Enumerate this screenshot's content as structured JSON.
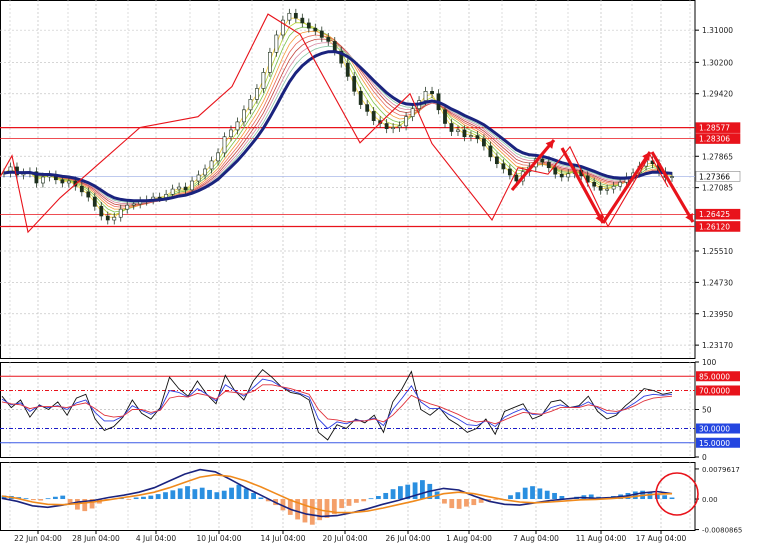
{
  "colors": {
    "background": "#ffffff",
    "grid": "#c8c8c8",
    "red_line": "#e8131b",
    "blue_line": "#1a237e",
    "current_line": "#aab8e8",
    "macd_pos": "#2a8fe0",
    "macd_neg": "#f4a06b",
    "macd_line": "#1a237e",
    "signal_line": "#f08a1c"
  },
  "chart_data": [
    {
      "type": "candlestick",
      "panel": "price",
      "y_ticks": [
        "1.31000",
        "1.30200",
        "1.29420",
        "1.27865",
        "1.27085",
        "1.25510",
        "1.24730",
        "1.23950",
        "1.23170"
      ],
      "ylim": [
        1.2285,
        1.3175
      ],
      "current_price": 1.27366,
      "price_labels": [
        {
          "label": "1.28577",
          "value": 1.28577
        },
        {
          "label": "1.28306",
          "value": 1.28306
        },
        {
          "label": "1.27366",
          "value": 1.27366
        },
        {
          "label": "1.26425",
          "value": 1.26425
        },
        {
          "label": "1.26120",
          "value": 1.2612
        }
      ],
      "support_resistance": [
        1.28577,
        1.28306,
        1.2642,
        1.2612
      ],
      "close_series": [
        1.2745,
        1.276,
        1.274,
        1.2745,
        1.2748,
        1.272,
        1.2735,
        1.274,
        1.2728,
        1.272,
        1.2725,
        1.2712,
        1.2698,
        1.2685,
        1.2662,
        1.2638,
        1.2628,
        1.2635,
        1.2655,
        1.2665,
        1.2668,
        1.2675,
        1.2678,
        1.2685,
        1.2684,
        1.2692,
        1.2705,
        1.271,
        1.2703,
        1.2725,
        1.274,
        1.2755,
        1.2775,
        1.2795,
        1.2835,
        1.2852,
        1.2872,
        1.2902,
        1.2928,
        1.2955,
        1.2995,
        1.3045,
        1.3088,
        1.3125,
        1.3142,
        1.313,
        1.3118,
        1.3105,
        1.3098,
        1.3082,
        1.3072,
        1.3048,
        1.3018,
        1.2985,
        1.2948,
        1.2915,
        1.2898,
        1.2875,
        1.2868,
        1.2855,
        1.2858,
        1.2862,
        1.2885,
        1.2905,
        1.2925,
        1.2948,
        1.2942,
        1.2902,
        1.2868,
        1.2848,
        1.2852,
        1.2835,
        1.2838,
        1.283,
        1.2812,
        1.2785,
        1.2768,
        1.2755,
        1.274,
        1.2725,
        1.2748,
        1.276,
        1.278,
        1.2772,
        1.2758,
        1.2742,
        1.2735,
        1.2743,
        1.2752,
        1.2738,
        1.2722,
        1.2712,
        1.2702,
        1.2705,
        1.2712,
        1.2722,
        1.2735,
        1.2745,
        1.2762,
        1.2775,
        1.2768,
        1.2748,
        1.2734,
        1.2736
      ]
    },
    {
      "type": "line",
      "panel": "oscillator",
      "y_ticks": [
        "100",
        "50",
        "0"
      ],
      "ylim": [
        0,
        100
      ],
      "levels": [
        {
          "label": "85.0000",
          "value": 85
        },
        {
          "label": "70.0000",
          "value": 70
        },
        {
          "label": "30.0000",
          "value": 30
        },
        {
          "label": "15.0000",
          "value": 15
        }
      ],
      "series": [
        {
          "values": [
            64,
            52,
            60,
            42,
            55,
            50,
            58,
            44,
            62,
            66,
            40,
            28,
            32,
            42,
            60,
            46,
            40,
            52,
            84,
            72,
            64,
            80,
            66,
            56,
            86,
            70,
            60,
            80,
            92,
            84,
            74,
            68,
            66,
            60,
            26,
            18,
            34,
            30,
            40,
            36,
            44,
            26,
            58,
            72,
            90,
            50,
            44,
            52,
            40,
            34,
            26,
            30,
            40,
            24,
            48,
            52,
            56,
            40,
            44,
            58,
            60,
            52,
            54,
            64,
            48,
            40,
            44,
            54,
            62,
            72,
            70,
            66,
            68
          ]
        },
        {
          "values": [
            61,
            55,
            57,
            48,
            54,
            52,
            54,
            50,
            57,
            60,
            47,
            38,
            38,
            43,
            54,
            49,
            45,
            50,
            70,
            68,
            63,
            72,
            66,
            59,
            76,
            70,
            64,
            73,
            82,
            80,
            74,
            70,
            67,
            63,
            40,
            30,
            37,
            35,
            39,
            38,
            41,
            33,
            50,
            62,
            75,
            58,
            51,
            51,
            45,
            40,
            34,
            33,
            38,
            32,
            42,
            47,
            51,
            45,
            45,
            52,
            55,
            52,
            53,
            58,
            52,
            46,
            46,
            51,
            57,
            64,
            66,
            65,
            66
          ]
        },
        {
          "values": [
            58,
            56,
            55,
            51,
            53,
            53,
            53,
            52,
            55,
            57,
            51,
            44,
            42,
            43,
            50,
            50,
            47,
            49,
            62,
            64,
            63,
            67,
            65,
            61,
            69,
            68,
            66,
            69,
            76,
            76,
            74,
            72,
            69,
            66,
            50,
            40,
            39,
            37,
            38,
            38,
            40,
            37,
            44,
            54,
            65,
            60,
            56,
            53,
            49,
            45,
            40,
            37,
            38,
            35,
            39,
            43,
            47,
            46,
            45,
            48,
            52,
            52,
            52,
            55,
            53,
            49,
            48,
            50,
            54,
            59,
            62,
            63,
            64
          ]
        }
      ]
    },
    {
      "type": "histogram",
      "panel": "macd",
      "y_ticks": [
        "0.0079617",
        "0.00",
        "-0.0080865"
      ],
      "ylim": [
        -0.0082,
        0.0098
      ],
      "histogram": [
        0.0009,
        0.0008,
        0.0005,
        0.0002,
        -0.0003,
        -0.0004,
        0.0002,
        0.0006,
        0.0009,
        -0.0012,
        -0.0028,
        -0.0032,
        -0.0025,
        -0.0012,
        -0.0003,
        0.0001,
        0.0002,
        -0.0001,
        0.0004,
        0.0006,
        0.0009,
        0.0013,
        0.0018,
        0.0023,
        0.0028,
        0.0034,
        0.0026,
        0.003,
        0.0024,
        0.0018,
        0.0022,
        0.003,
        0.0038,
        0.0028,
        0.0016,
        0.0004,
        -0.0006,
        -0.0016,
        -0.003,
        -0.0042,
        -0.0054,
        -0.0062,
        -0.0068,
        -0.0056,
        -0.005,
        -0.004,
        -0.0024,
        -0.0018,
        -0.001,
        -0.0006,
        0.0002,
        0.0008,
        0.0016,
        0.0026,
        0.0034,
        0.0038,
        0.0044,
        0.005,
        0.004,
        0.002,
        -0.0012,
        -0.0024,
        -0.0026,
        -0.002,
        -0.0016,
        -0.001,
        -0.0006,
        -0.0002,
        0.0,
        0.001,
        0.0018,
        0.003,
        0.0034,
        0.0028,
        0.0022,
        0.0016,
        0.0008,
        0.0002,
        0.0006,
        0.001,
        0.0012,
        0.0006,
        0.0004,
        0.0008,
        0.0012,
        0.0016,
        0.002,
        0.0022,
        0.0018,
        0.0014,
        0.001,
        0.0004
      ],
      "series": [
        {
          "values": [
            0.0002,
            -0.0006,
            -0.0018,
            -0.0022,
            -0.0016,
            -0.0008,
            -0.0004,
            0.0004,
            0.001,
            0.0018,
            0.003,
            0.0048,
            0.0066,
            0.0078,
            0.0072,
            0.0052,
            0.003,
            0.001,
            -0.001,
            -0.0028,
            -0.004,
            -0.0046,
            -0.0044,
            -0.0036,
            -0.0026,
            -0.0014,
            -0.0004,
            0.0008,
            0.002,
            0.0028,
            0.0024,
            0.0008,
            -0.0006,
            -0.0014,
            -0.0016,
            -0.001,
            -0.0004,
            0.0,
            0.0004,
            0.0002,
            0.0004,
            0.0008,
            0.0016,
            0.002,
            0.0014
          ]
        },
        {
          "values": [
            0.0008,
            0.0002,
            -0.0008,
            -0.0014,
            -0.0015,
            -0.0012,
            -0.0008,
            -0.0002,
            0.0004,
            0.001,
            0.0018,
            0.003,
            0.0044,
            0.0058,
            0.0064,
            0.006,
            0.0048,
            0.0032,
            0.0014,
            -0.0004,
            -0.0018,
            -0.003,
            -0.0036,
            -0.0036,
            -0.0032,
            -0.0024,
            -0.0015,
            -0.0006,
            0.0004,
            0.0014,
            0.0018,
            0.0014,
            0.0006,
            -0.0002,
            -0.0008,
            -0.001,
            -0.0008,
            -0.0005,
            -0.0002,
            -0.0001,
            0.0001,
            0.0004,
            0.0009,
            0.0013,
            0.0014
          ]
        }
      ]
    },
    {
      "type": "axis",
      "panel": "time",
      "x_ticks": [
        "22 Jun 04:00",
        "28 Jun 04:00",
        "4 Jul 04:00",
        "10 Jul 04:00",
        "14 Jul 04:00",
        "20 Jul 04:00",
        "26 Jul 04:00",
        "1 Aug 04:00",
        "7 Aug 04:00",
        "11 Aug 04:00",
        "17 Aug 04:00"
      ]
    }
  ]
}
